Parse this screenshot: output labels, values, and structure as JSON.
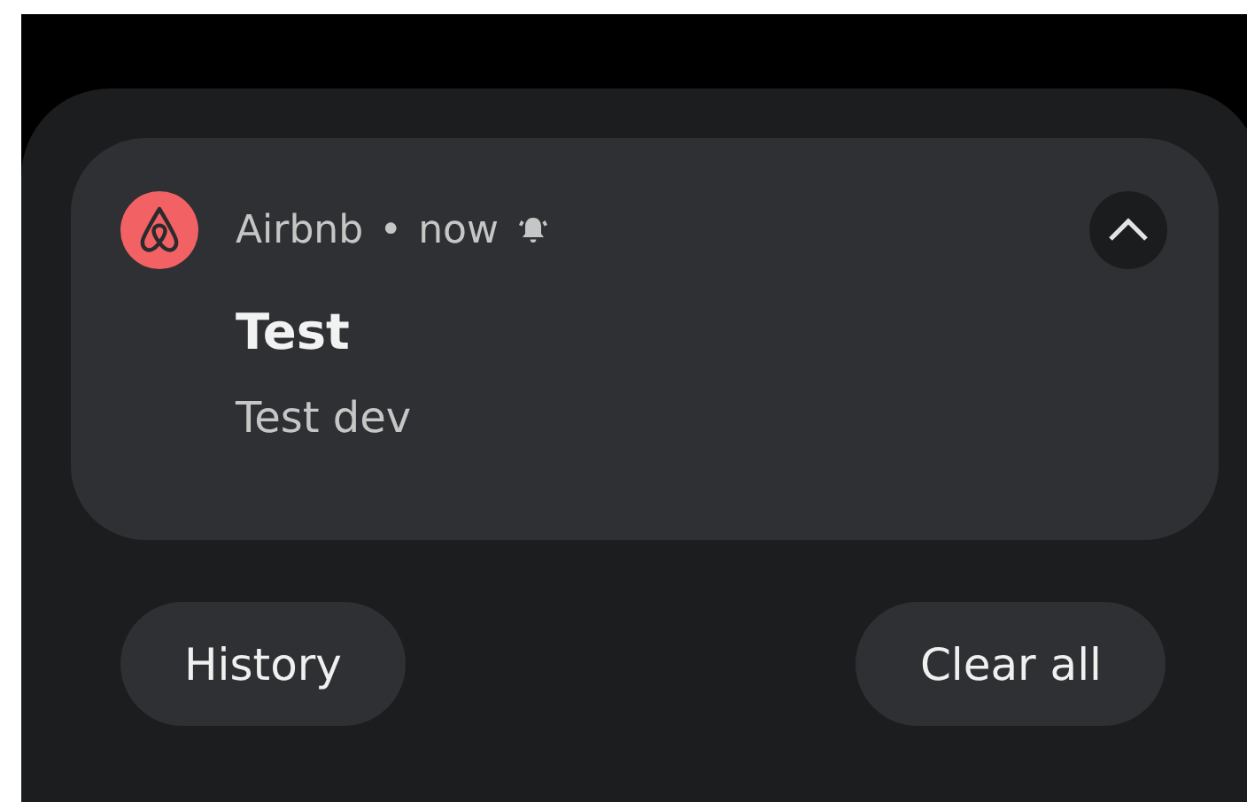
{
  "notification": {
    "app": "Airbnb",
    "separator": "•",
    "time": "now",
    "title": "Test",
    "text": "Test dev",
    "expanded": true
  },
  "buttons": [
    {
      "label": "History"
    },
    {
      "label": "Clear all"
    }
  ]
}
